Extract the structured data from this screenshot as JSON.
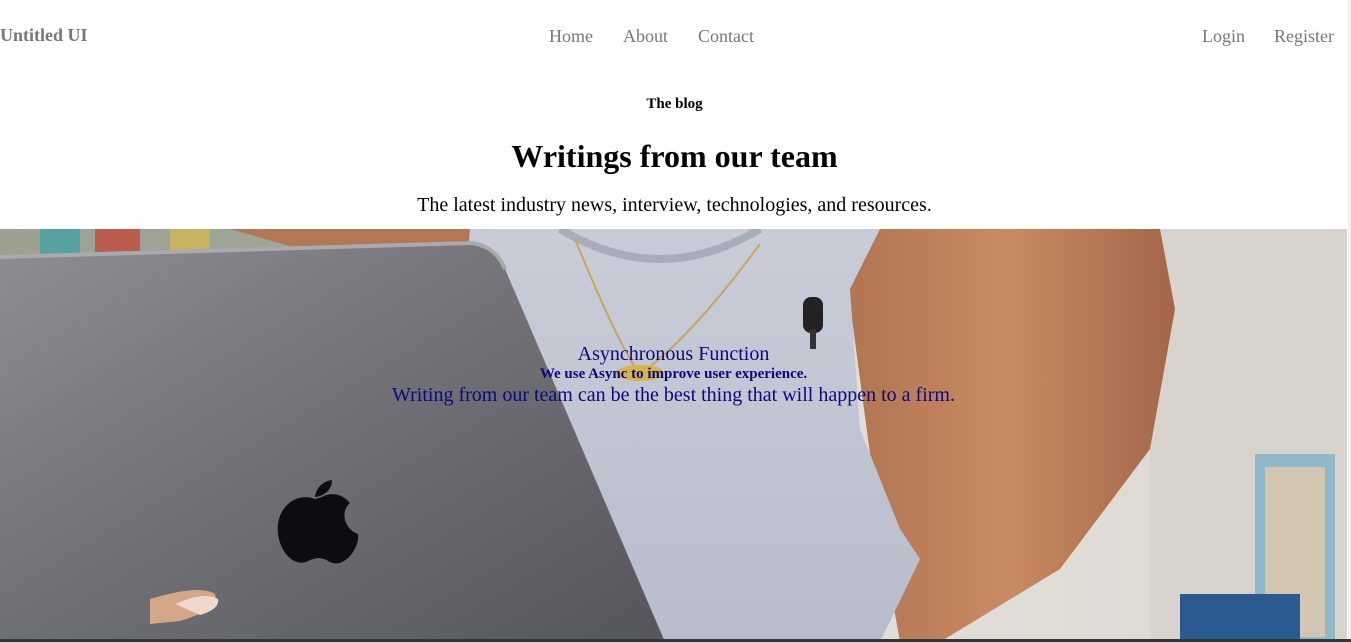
{
  "nav": {
    "brand": "Untitled UI",
    "links": [
      "Home",
      "About",
      "Contact"
    ],
    "auth": {
      "login": "Login",
      "register": "Register"
    }
  },
  "header": {
    "eyebrow": "The blog",
    "title": "Writings from our team",
    "subtitle": "The latest industry news, interview, technologies, and resources."
  },
  "banner": {
    "title": "Asynchronous Function",
    "subtitle": "We use Async to improve user experience.",
    "body": "Writing from our team can be the best thing that will happen to a firm."
  },
  "colors": {
    "nav_text": "#777777",
    "overlay_text": "#0a0a7a",
    "heading_text": "#000000"
  }
}
